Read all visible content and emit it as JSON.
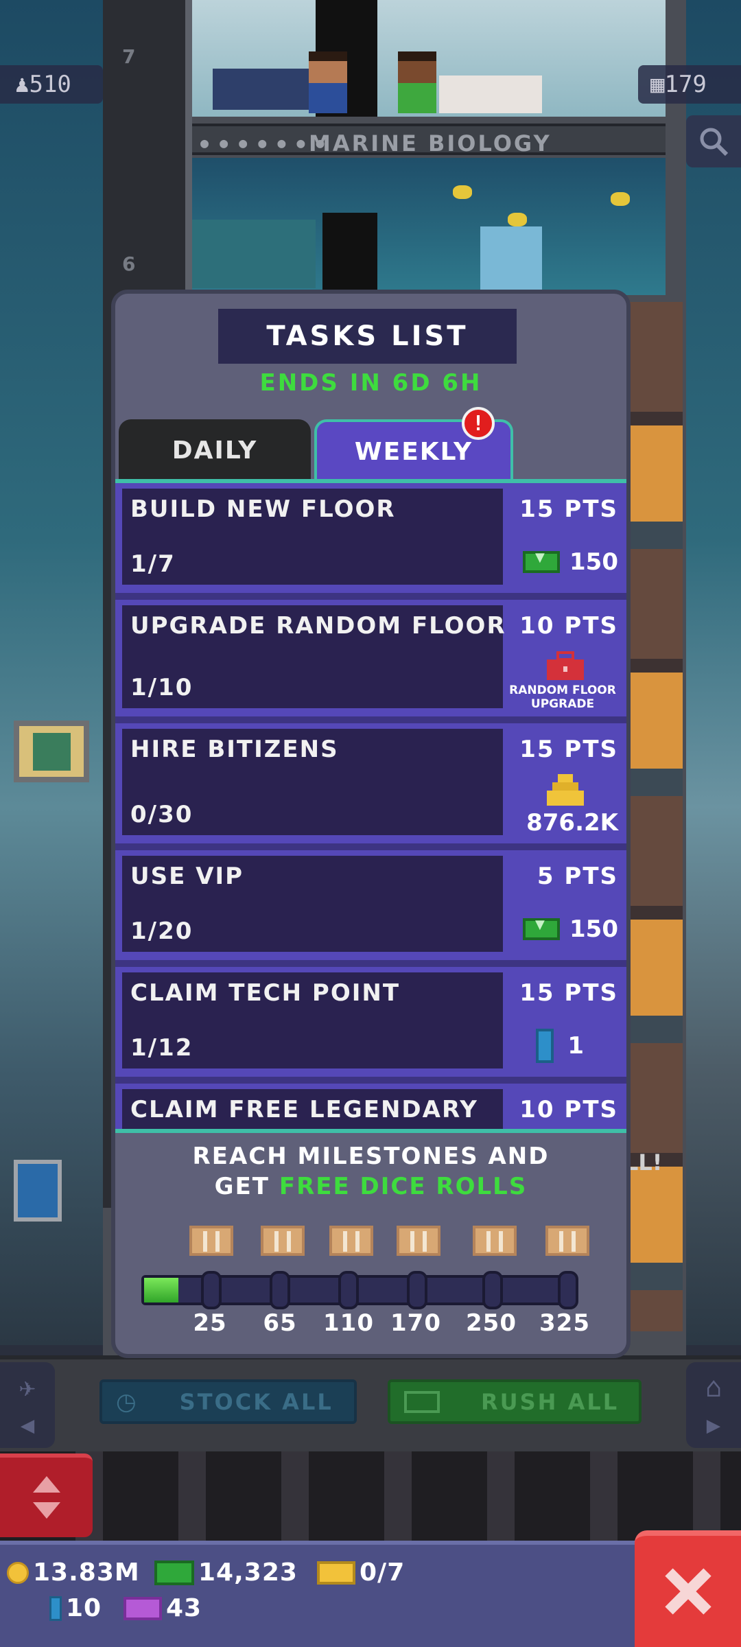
{
  "scene": {
    "population": "510",
    "floor_count": "179",
    "floor_labels": [
      "7",
      "6"
    ],
    "floor_sign": "MARINE BIOLOGY",
    "stock_all_label": "STOCK ALL",
    "rush_all_label": "RUSH ALL",
    "billboard_fragment": "LL!"
  },
  "modal": {
    "title": "TASKS LIST",
    "ends_in": "ENDS IN 6D 6H",
    "tabs": [
      {
        "label": "DAILY",
        "active": false
      },
      {
        "label": "WEEKLY",
        "active": true
      }
    ],
    "weekly_badge": "!",
    "tasks": [
      {
        "name": "BUILD NEW FLOOR",
        "progress": "1/7",
        "points": "15 PTS",
        "reward_icon": "cash-icon",
        "reward_value": "150"
      },
      {
        "name": "UPGRADE RANDOM FLOOR",
        "progress": "1/10",
        "points": "10 PTS",
        "reward_icon": "toolbox-icon",
        "reward_value": "RANDOM FLOOR UPGRADE"
      },
      {
        "name": "HIRE BITIZENS",
        "progress": "0/30",
        "points": "15 PTS",
        "reward_icon": "coin-stack-icon",
        "reward_value": "876.2K"
      },
      {
        "name": "USE VIP",
        "progress": "1/20",
        "points": "5 PTS",
        "reward_icon": "cash-icon",
        "reward_value": "150"
      },
      {
        "name": "CLAIM TECH POINT",
        "progress": "1/12",
        "points": "15 PTS",
        "reward_icon": "tech-point-icon",
        "reward_value": "1"
      },
      {
        "name": "CLAIM FREE LEGENDARY",
        "progress": "",
        "points": "10 PTS",
        "reward_icon": "",
        "reward_value": ""
      }
    ],
    "milestone_line1": "REACH MILESTONES AND",
    "milestone_line2_prefix": "GET",
    "milestone_line2_highlight": "FREE DICE ROLLS",
    "milestones": [
      "25",
      "65",
      "110",
      "170",
      "250",
      "325"
    ],
    "milestone_progress": 0.08,
    "colors": {
      "accent_green": "#3edc3e",
      "tab_active": "#5a48c2",
      "task_panel": "#2a2250"
    }
  },
  "currency": {
    "coins": "13.83M",
    "bux": "14,323",
    "golden_tickets": "0/7",
    "tech_points": "10",
    "legendary_tickets": "43"
  }
}
